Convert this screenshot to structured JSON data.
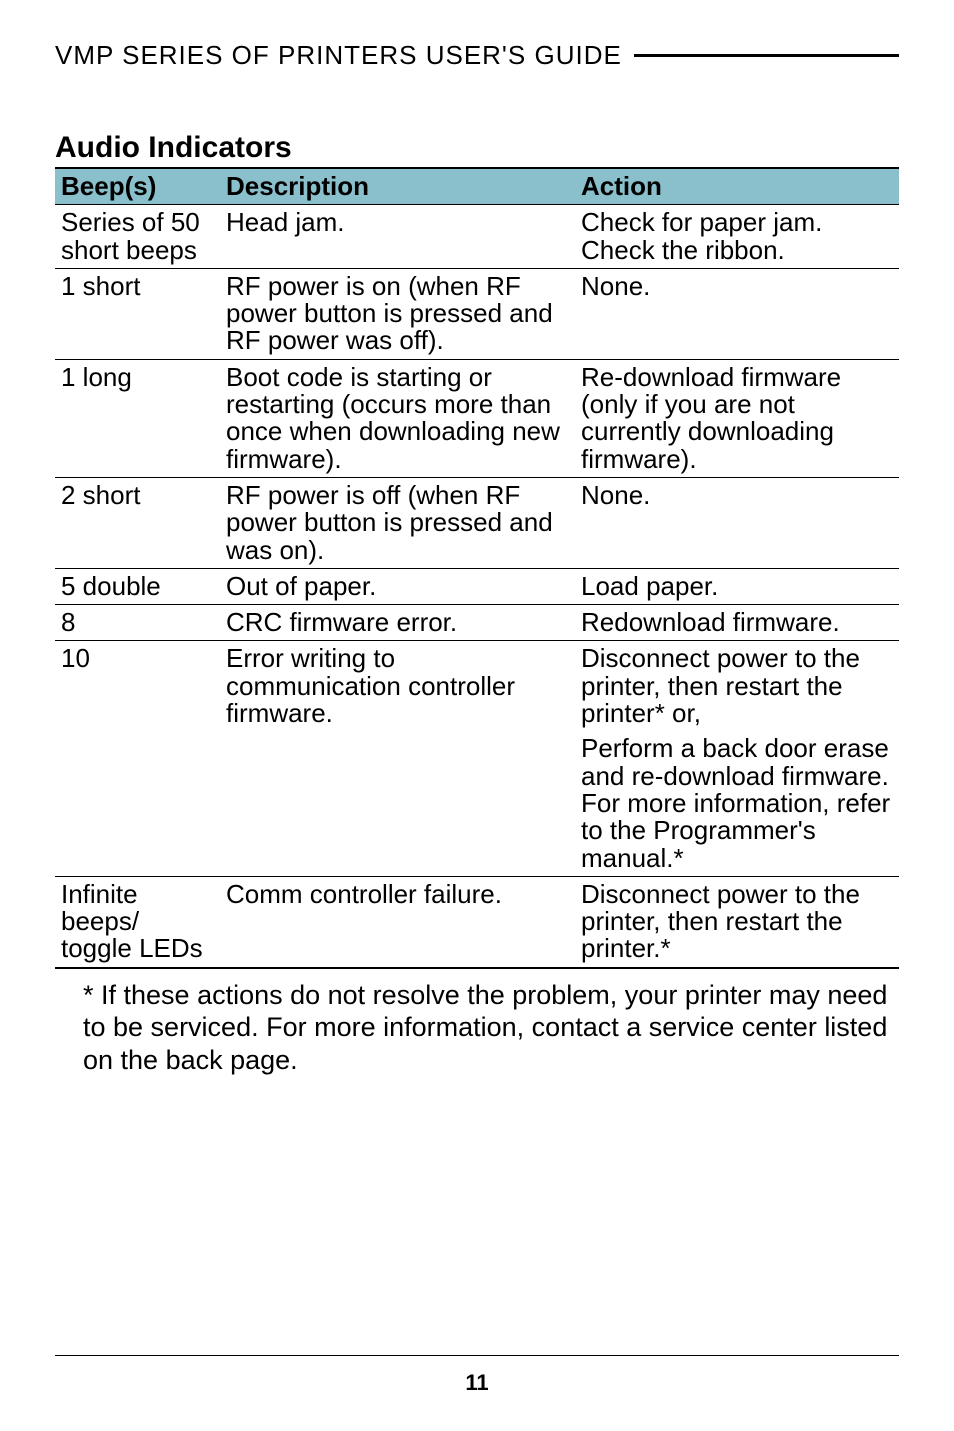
{
  "header": "VMP SERIES OF PRINTERS USER'S GUIDE",
  "section_title": "Audio Indicators",
  "table": {
    "headers": {
      "beeps": "Beep(s)",
      "description": "Description",
      "action": "Action"
    },
    "rows": [
      {
        "beeps": "Series of 50 short beeps",
        "description": "Head jam.",
        "action": "Check for paper jam. Check the ribbon."
      },
      {
        "beeps": "1 short",
        "description": "RF power is on (when RF power button is pressed and RF power was off).",
        "action": "None."
      },
      {
        "beeps": "1 long",
        "description": "Boot code is starting or restarting (occurs more than once when downloading new firmware).",
        "action": "Re-download firmware (only if you are not currently downloading firmware)."
      },
      {
        "beeps": "2 short",
        "description": "RF power is off (when RF power button is pressed and was on).",
        "action": "None."
      },
      {
        "beeps": "5 double",
        "description": "Out of paper.",
        "action": "Load paper."
      },
      {
        "beeps": "8",
        "description": "CRC firmware error.",
        "action": "Redownload firmware."
      },
      {
        "beeps": "10",
        "description": "Error writing to communication controller firmware.",
        "action": "Disconnect power to the printer, then restart the printer* or,"
      },
      {
        "beeps": "",
        "description": "",
        "action": "Perform a back door erase and re-download firmware. For more information, refer to the Programmer's manual.*"
      },
      {
        "beeps": "Infinite beeps/ toggle LEDs",
        "description": "Comm controller failure.",
        "action": "Disconnect power to the printer, then restart the printer.*"
      }
    ]
  },
  "footnote": "* If these actions do not resolve the problem, your printer may need to be serviced. For more information, contact a service center listed on the back page.",
  "page_number": "11"
}
